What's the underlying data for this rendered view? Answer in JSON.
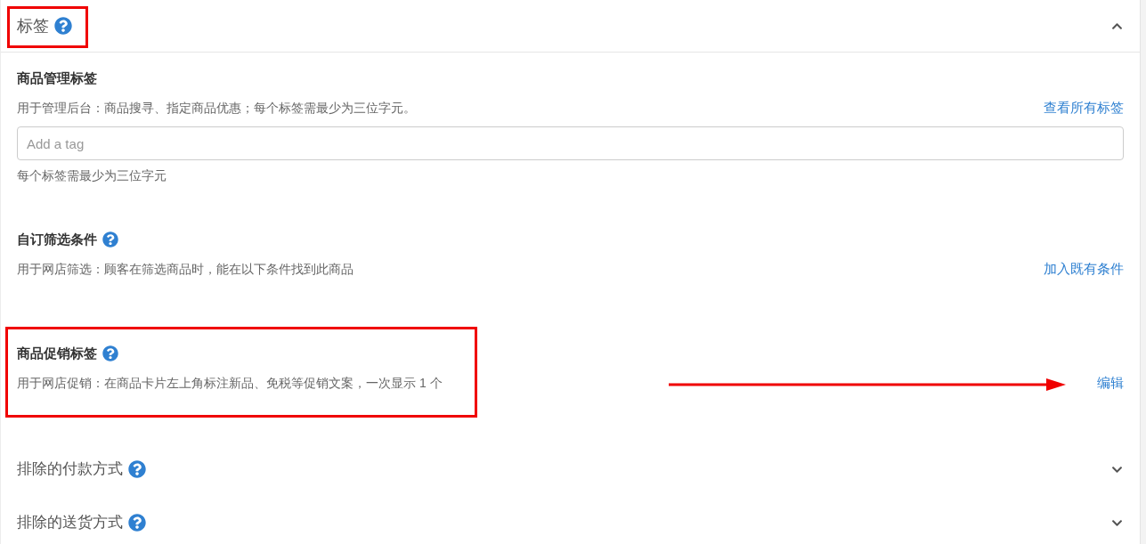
{
  "panels": [
    {
      "title": "标签",
      "help": true,
      "expanded": true,
      "highlighted": true,
      "fields": [
        {
          "title": "商品管理标签",
          "help": false,
          "description": "用于管理后台：商品搜寻、指定商品优惠；每个标签需最少为三位字元。",
          "action": "查看所有标签",
          "input": {
            "placeholder": "Add a tag"
          },
          "hint": "每个标签需最少为三位字元",
          "highlighted": false,
          "arrow": false
        },
        {
          "title": "自订筛选条件",
          "help": true,
          "description": "用于网店筛选：顾客在筛选商品时，能在以下条件找到此商品",
          "action": "加入既有条件",
          "highlighted": false,
          "arrow": false
        },
        {
          "title": "商品促销标签",
          "help": true,
          "description": "用于网店促销：在商品卡片左上角标注新品、免税等促销文案，一次显示 1 个",
          "action": "编辑",
          "highlighted": true,
          "arrow": true
        }
      ]
    },
    {
      "title": "排除的付款方式",
      "help": true,
      "expanded": false,
      "highlighted": false
    },
    {
      "title": "排除的送货方式",
      "help": true,
      "expanded": false,
      "highlighted": false
    }
  ]
}
